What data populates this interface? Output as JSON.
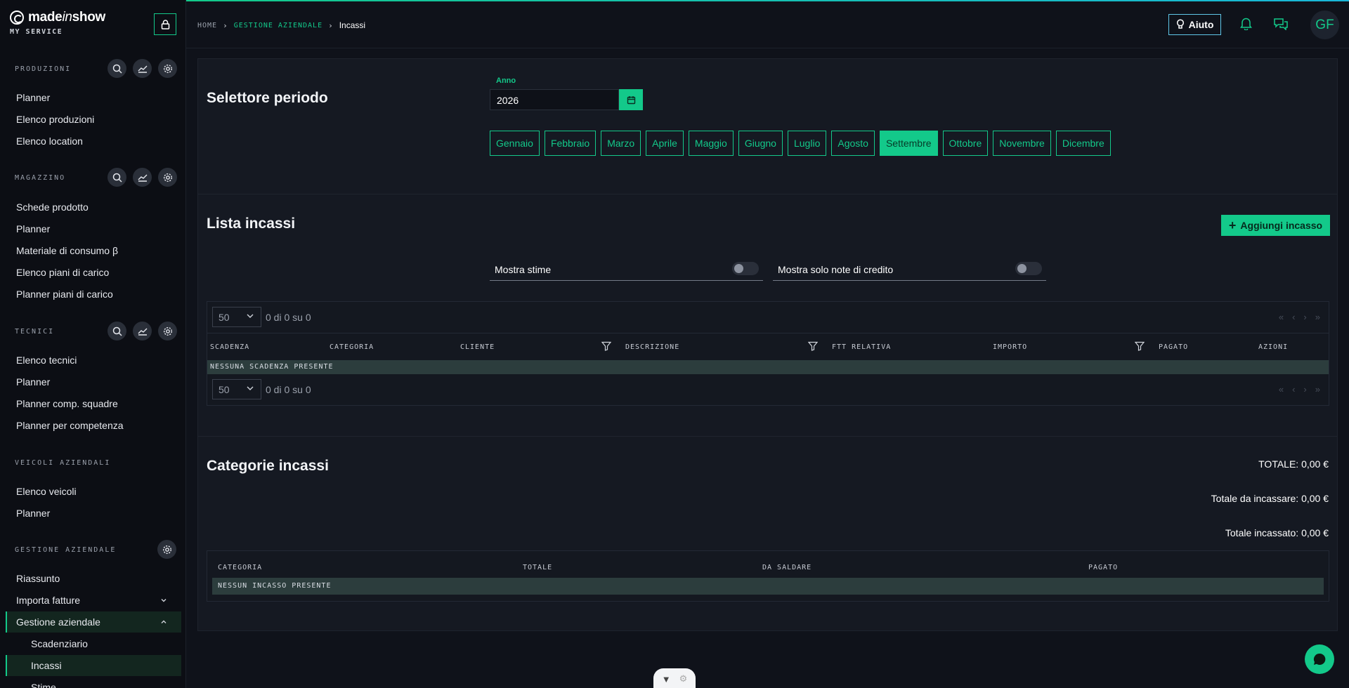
{
  "brand": {
    "name_prefix": "made",
    "name_italic": "in",
    "name_suffix": "show",
    "subtitle": "MY SERVICE"
  },
  "sidebar": {
    "sections": [
      {
        "title": "PRODUZIONI",
        "items": [
          "Planner",
          "Elenco produzioni",
          "Elenco location"
        ]
      },
      {
        "title": "MAGAZZINO",
        "items": [
          "Schede prodotto",
          "Planner",
          "Materiale di consumo β",
          "Elenco piani di carico",
          "Planner piani di carico"
        ]
      },
      {
        "title": "TECNICI",
        "items": [
          "Elenco tecnici",
          "Planner",
          "Planner comp. squadre",
          "Planner per competenza"
        ]
      },
      {
        "title": "VEICOLI AZIENDALI",
        "items": [
          "Elenco veicoli",
          "Planner"
        ]
      },
      {
        "title": "GESTIONE AZIENDALE",
        "items": [
          "Riassunto",
          "Importa fatture",
          "Gestione aziendale"
        ],
        "subitems": [
          "Scadenziario",
          "Incassi",
          "Stime"
        ]
      }
    ]
  },
  "header": {
    "breadcrumb": [
      "HOME",
      "GESTIONE AZIENDALE",
      "Incassi"
    ],
    "help_label": "Aiuto",
    "avatar_initials": "GF"
  },
  "period": {
    "title": "Selettore periodo",
    "year_label": "Anno",
    "year_value": "2026",
    "months": [
      "Gennaio",
      "Febbraio",
      "Marzo",
      "Aprile",
      "Maggio",
      "Giugno",
      "Luglio",
      "Agosto",
      "Settembre",
      "Ottobre",
      "Novembre",
      "Dicembre"
    ],
    "selected_month": "Settembre"
  },
  "incassi": {
    "title": "Lista incassi",
    "add_label": "Aggiungi incasso",
    "toggle_stime": "Mostra stime",
    "toggle_note": "Mostra solo note di credito",
    "page_size": "50",
    "page_info": "0 di 0 su 0",
    "columns": [
      "SCADENZA",
      "CATEGORIA",
      "CLIENTE",
      "DESCRIZIONE",
      "FTT RELATIVA",
      "IMPORTO",
      "PAGATO",
      "AZIONI"
    ],
    "empty_text": "NESSUNA SCADENZA PRESENTE"
  },
  "categorie": {
    "title": "Categorie incassi",
    "totale": "TOTALE: 0,00 €",
    "da_incassare": "Totale da incassare: 0,00 €",
    "incassato": "Totale incassato: 0,00 €",
    "columns": [
      "CATEGORIA",
      "TOTALE",
      "DA SALDARE",
      "PAGATO"
    ],
    "empty_text": "NESSUN INCASSO PRESENTE"
  },
  "colors": {
    "accent": "#13c98a",
    "background": "#0f121a",
    "panel": "#151922"
  }
}
